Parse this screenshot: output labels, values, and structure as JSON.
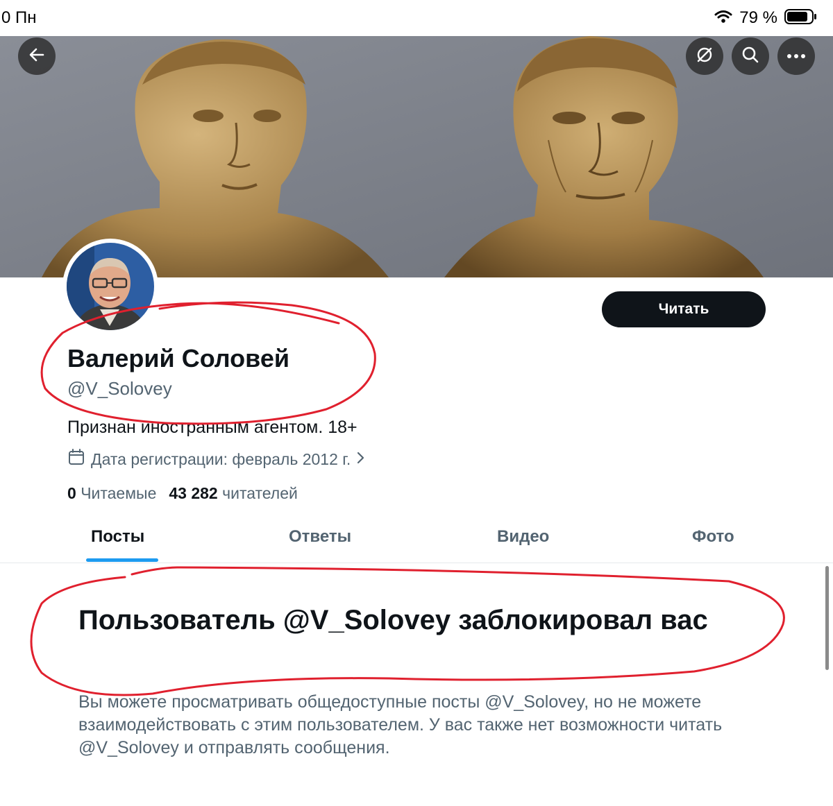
{
  "status_bar": {
    "time": "0 Пн",
    "battery_percent": "79 %",
    "icons": [
      "wifi-icon",
      "battery-icon"
    ]
  },
  "header_actions": {
    "back_icon": "arrow-left-icon",
    "grok_icon": "grok-slash-icon",
    "search_icon": "search-icon",
    "more_icon": "more-horizontal-icon"
  },
  "profile": {
    "name": "Валерий Соловей",
    "handle": "@V_Solovey",
    "bio": "Признан иностранным агентом. 18+",
    "joined": "Дата регистрации: февраль 2012 г.",
    "following_count": "0",
    "following_label": "Читаемые",
    "followers_count": "43 282",
    "followers_label": "читателей",
    "follow_button": "Читать"
  },
  "tabs": [
    {
      "label": "Посты",
      "active": true
    },
    {
      "label": "Ответы",
      "active": false
    },
    {
      "label": "Видео",
      "active": false
    },
    {
      "label": "Фото",
      "active": false
    }
  ],
  "blocked": {
    "title": "Пользователь @V_Solovey заблокировал вас",
    "description": "Вы можете просматривать общедоступные посты @V_Solovey, но не можете взаимодействовать с этим пользователем. У вас также нет возможности читать @V_Solovey и отправлять сообщения."
  },
  "colors": {
    "accent": "#1d9bf0",
    "text_primary": "#0f1419",
    "text_secondary": "#536471",
    "annotation": "#e0202e"
  }
}
